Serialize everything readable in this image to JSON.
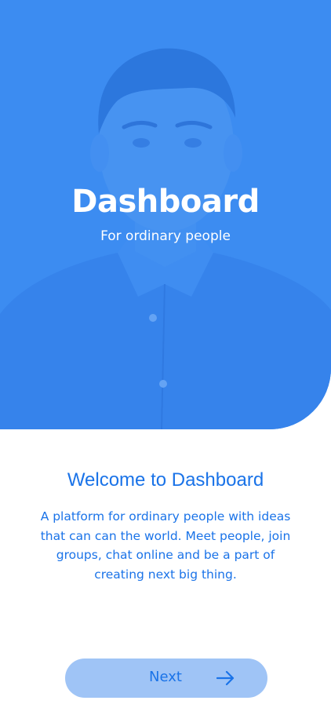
{
  "hero": {
    "title": "Dashboard",
    "subtitle": "For ordinary people"
  },
  "welcome": {
    "title": "Welcome to Dashboard",
    "description": "A platform for ordinary people with ideas that can can the world. Meet people, join groups, chat online and be a part of creating next big thing."
  },
  "actions": {
    "next_label": "Next",
    "next_icon": "arrow-right-icon"
  },
  "colors": {
    "primary": "#1a73e8",
    "hero_blue": "#3f8ef2",
    "button_bg": "#9fc4f6",
    "background": "#ffffff"
  }
}
